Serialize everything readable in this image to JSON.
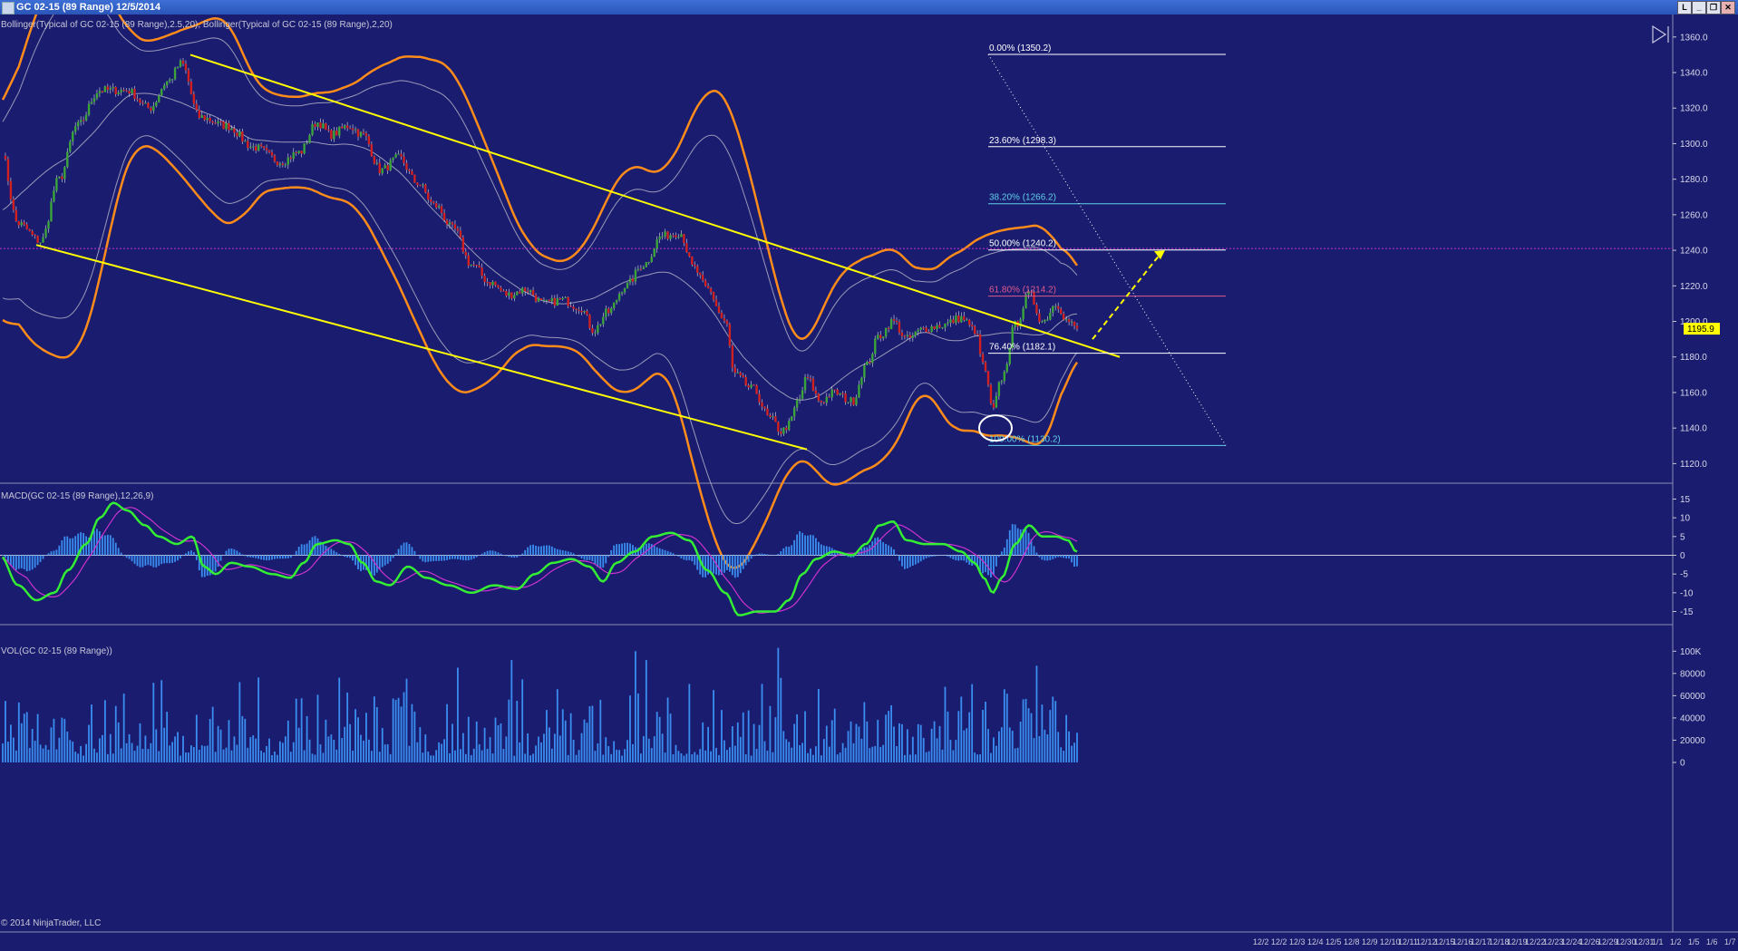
{
  "window": {
    "title": "GC 02-15 (89 Range)  12/5/2014",
    "buttons": [
      "L",
      "_",
      "❐",
      "✕"
    ]
  },
  "price_panel": {
    "label": "Bollinger(Typical of GC 02-15 (89 Range),2.5,20), Bollinger(Typical of GC 02-15 (89 Range),2,20)",
    "last_price": "1195.9"
  },
  "macd_panel": {
    "label": "MACD(GC 02-15 (89 Range),12,26,9)"
  },
  "vol_panel": {
    "label": "VOL(GC 02-15 (89 Range))"
  },
  "copyright": "© 2014 NinjaTrader, LLC",
  "fibonacci": [
    {
      "label": "0.00% (1350.2)",
      "price": 1350.2,
      "color": "#ffffff"
    },
    {
      "label": "23.60% (1298.3)",
      "price": 1298.3,
      "color": "#ffffff"
    },
    {
      "label": "38.20% (1266.2)",
      "price": 1266.2,
      "color": "#5fd0e8"
    },
    {
      "label": "50.00% (1240.2)",
      "price": 1240.2,
      "color": "#ffffff"
    },
    {
      "label": "61.80% (1214.2)",
      "price": 1214.2,
      "color": "#e05a8a"
    },
    {
      "label": "76.40% (1182.1)",
      "price": 1182.1,
      "color": "#ffffff"
    },
    {
      "label": "100.00% (1130.2)",
      "price": 1130.2,
      "color": "#5fd0e8"
    }
  ],
  "colors": {
    "background": "#1a1c70",
    "bollinger_outer": "#ff8c1a",
    "bollinger_inner": "#9a9ab8",
    "channel": "#ffff00",
    "candle_up": "#3aa43a",
    "candle_down": "#d02020",
    "macd": "#33ee33",
    "signal": "#cc33cc",
    "histogram": "#3a8ef0",
    "volume": "#3a8ef0",
    "horizontal_line": "#cc33cc",
    "last_price_tag": "#ffff00"
  },
  "x_axis_labels": [
    "12/2",
    "12/2",
    "12/3",
    "12/4",
    "12/5",
    "12/8",
    "12/9",
    "12/10",
    "12/11",
    "12/12",
    "12/15",
    "12/16",
    "12/17",
    "12/18",
    "12/19",
    "12/22",
    "12/23",
    "12/24",
    "12/26",
    "12/29",
    "12/30",
    "12/31",
    "1/1",
    "1/2",
    "1/5",
    "1/6",
    "1/7"
  ],
  "chart_data": [
    {
      "type": "candlestick",
      "title": "GC 02-15 (89 Range)",
      "y_axis": {
        "min": 1120,
        "max": 1360,
        "ticks": [
          1360,
          1340,
          1320,
          1300,
          1280,
          1260,
          1240,
          1220,
          1200,
          1180,
          1160,
          1140,
          1120
        ]
      },
      "close_path_anchors": [
        [
          0,
          1298
        ],
        [
          20,
          1255
        ],
        [
          45,
          1245
        ],
        [
          65,
          1280
        ],
        [
          85,
          1310
        ],
        [
          110,
          1330
        ],
        [
          140,
          1330
        ],
        [
          165,
          1320
        ],
        [
          185,
          1335
        ],
        [
          200,
          1345
        ],
        [
          220,
          1315
        ],
        [
          250,
          1310
        ],
        [
          280,
          1298
        ],
        [
          310,
          1290
        ],
        [
          330,
          1295
        ],
        [
          350,
          1312
        ],
        [
          365,
          1305
        ],
        [
          385,
          1310
        ],
        [
          400,
          1305
        ],
        [
          420,
          1285
        ],
        [
          440,
          1292
        ],
        [
          460,
          1278
        ],
        [
          480,
          1265
        ],
        [
          500,
          1252
        ],
        [
          520,
          1232
        ],
        [
          540,
          1222
        ],
        [
          560,
          1215
        ],
        [
          580,
          1218
        ],
        [
          600,
          1210
        ],
        [
          620,
          1212
        ],
        [
          640,
          1208
        ],
        [
          655,
          1195
        ],
        [
          670,
          1205
        ],
        [
          690,
          1220
        ],
        [
          710,
          1232
        ],
        [
          730,
          1248
        ],
        [
          750,
          1250
        ],
        [
          765,
          1230
        ],
        [
          780,
          1218
        ],
        [
          800,
          1200
        ],
        [
          810,
          1170
        ],
        [
          830,
          1162
        ],
        [
          850,
          1145
        ],
        [
          862,
          1138
        ],
        [
          870,
          1142
        ],
        [
          880,
          1155
        ],
        [
          890,
          1168
        ],
        [
          905,
          1155
        ],
        [
          920,
          1160
        ],
        [
          940,
          1155
        ],
        [
          955,
          1175
        ],
        [
          970,
          1192
        ],
        [
          985,
          1200
        ],
        [
          1000,
          1190
        ],
        [
          1020,
          1196
        ],
        [
          1040,
          1198
        ],
        [
          1060,
          1202
        ],
        [
          1075,
          1195
        ],
        [
          1085,
          1175
        ],
        [
          1095,
          1150
        ],
        [
          1105,
          1168
        ],
        [
          1120,
          1198
        ],
        [
          1135,
          1215
        ],
        [
          1150,
          1200
        ],
        [
          1165,
          1210
        ],
        [
          1178,
          1200
        ],
        [
          1187,
          1196
        ]
      ],
      "last": 1195.9,
      "overlays": [
        {
          "name": "Bollinger(Typical of GC 02-15 (89 Range),2.5,20)",
          "period": 20,
          "std_dev": 2.5
        },
        {
          "name": "Bollinger(Typical of GC 02-15 (89 Range),2,20)",
          "period": 20,
          "std_dev": 2
        }
      ],
      "horizontal_line": 1241,
      "channel_lines": [
        {
          "from": [
            40,
            1243
          ],
          "to": [
            890,
            1128
          ]
        },
        {
          "from": [
            210,
            1350
          ],
          "to": [
            1235,
            1180
          ]
        }
      ],
      "fib_retracement": {
        "high": 1350.2,
        "low": 1130.2
      },
      "projection_arrow": {
        "from": [
          1205,
          1190
        ],
        "to": [
          1285,
          1240
        ]
      }
    },
    {
      "type": "line",
      "title": "MACD(GC 02-15 (89 Range),12,26,9)",
      "y_axis": {
        "min": -17,
        "max": 17,
        "ticks": [
          15,
          10,
          5,
          0,
          -5,
          -10,
          -15
        ]
      },
      "series": [
        {
          "name": "MACD",
          "anchors": [
            [
              0,
              0
            ],
            [
              20,
              -8
            ],
            [
              40,
              -12
            ],
            [
              60,
              -10
            ],
            [
              75,
              -4
            ],
            [
              95,
              3
            ],
            [
              110,
              10
            ],
            [
              125,
              14
            ],
            [
              140,
              12
            ],
            [
              160,
              8
            ],
            [
              175,
              5
            ],
            [
              195,
              3
            ],
            [
              212,
              5
            ],
            [
              225,
              -3
            ],
            [
              238,
              -5
            ],
            [
              255,
              -2
            ],
            [
              275,
              -3
            ],
            [
              300,
              -5
            ],
            [
              320,
              -6
            ],
            [
              335,
              -2
            ],
            [
              350,
              3
            ],
            [
              370,
              4
            ],
            [
              385,
              3
            ],
            [
              400,
              -2
            ],
            [
              415,
              -7
            ],
            [
              430,
              -8
            ],
            [
              450,
              -3
            ],
            [
              470,
              -6
            ],
            [
              495,
              -8
            ],
            [
              520,
              -10
            ],
            [
              545,
              -8
            ],
            [
              570,
              -9
            ],
            [
              590,
              -5
            ],
            [
              610,
              -2
            ],
            [
              630,
              -1
            ],
            [
              650,
              -3
            ],
            [
              665,
              -7
            ],
            [
              680,
              -2
            ],
            [
              700,
              1
            ],
            [
              720,
              5
            ],
            [
              740,
              6
            ],
            [
              760,
              4
            ],
            [
              780,
              -4
            ],
            [
              800,
              -10
            ],
            [
              815,
              -16
            ],
            [
              835,
              -15
            ],
            [
              855,
              -15
            ],
            [
              870,
              -12
            ],
            [
              885,
              -5
            ],
            [
              900,
              -1
            ],
            [
              920,
              1
            ],
            [
              940,
              0
            ],
            [
              955,
              3
            ],
            [
              970,
              8
            ],
            [
              985,
              9
            ],
            [
              1000,
              4
            ],
            [
              1020,
              3
            ],
            [
              1040,
              3
            ],
            [
              1060,
              1
            ],
            [
              1075,
              -2
            ],
            [
              1085,
              -6
            ],
            [
              1095,
              -10
            ],
            [
              1105,
              -6
            ],
            [
              1120,
              3
            ],
            [
              1135,
              8
            ],
            [
              1150,
              5
            ],
            [
              1165,
              5
            ],
            [
              1178,
              4
            ],
            [
              1187,
              1
            ]
          ]
        },
        {
          "name": "Signal",
          "lag": 9
        }
      ],
      "histogram": "MACD - Signal"
    },
    {
      "type": "bar",
      "title": "VOL(GC 02-15 (89 Range))",
      "y_axis": {
        "min": 0,
        "max": 110000,
        "ticks": [
          100000,
          80000,
          60000,
          40000,
          20000,
          0
        ],
        "tick_labels": [
          "100K",
          "80000",
          "60000",
          "40000",
          "20000",
          "0"
        ]
      },
      "notable_peaks": [
        [
          700,
          100000
        ],
        [
          858,
          103000
        ],
        [
          712,
          92000
        ],
        [
          565,
          92000
        ]
      ]
    }
  ]
}
